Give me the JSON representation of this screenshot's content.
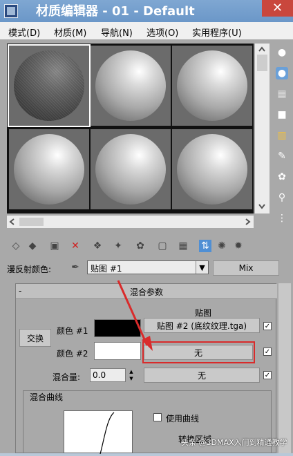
{
  "window": {
    "title": "材质编辑器 - 01 - Default",
    "close_glyph": "✕"
  },
  "menu": [
    "模式(D)",
    "材质(M)",
    "导航(N)",
    "选项(O)",
    "实用程序(U)"
  ],
  "params": {
    "diffuse_label": "漫反射颜色:",
    "material_value": "贴图 #1",
    "type_button": "Mix",
    "rollout_minus": "-",
    "rollout_title": "混合参数",
    "maps_header": "贴图",
    "swap_button": "交换",
    "color1_label": "颜色 #1",
    "color1_map": "贴图 #2 (底纹纹理.tga)",
    "color2_label": "颜色 #2",
    "color2_map": "无",
    "mix_amount_label": "混合量:",
    "mix_amount_value": "0.0",
    "mix_amount_map": "无",
    "curve_group_title": "混合曲线",
    "use_curve_label": "使用曲线",
    "transition_label": "转换区域"
  },
  "colors": {
    "color1": "#000000",
    "color2": "#ffffff",
    "highlight": "#d92b2b",
    "accent": "#4f8fd4"
  },
  "watermark": "头条 @3DMAX入门到精通教学"
}
